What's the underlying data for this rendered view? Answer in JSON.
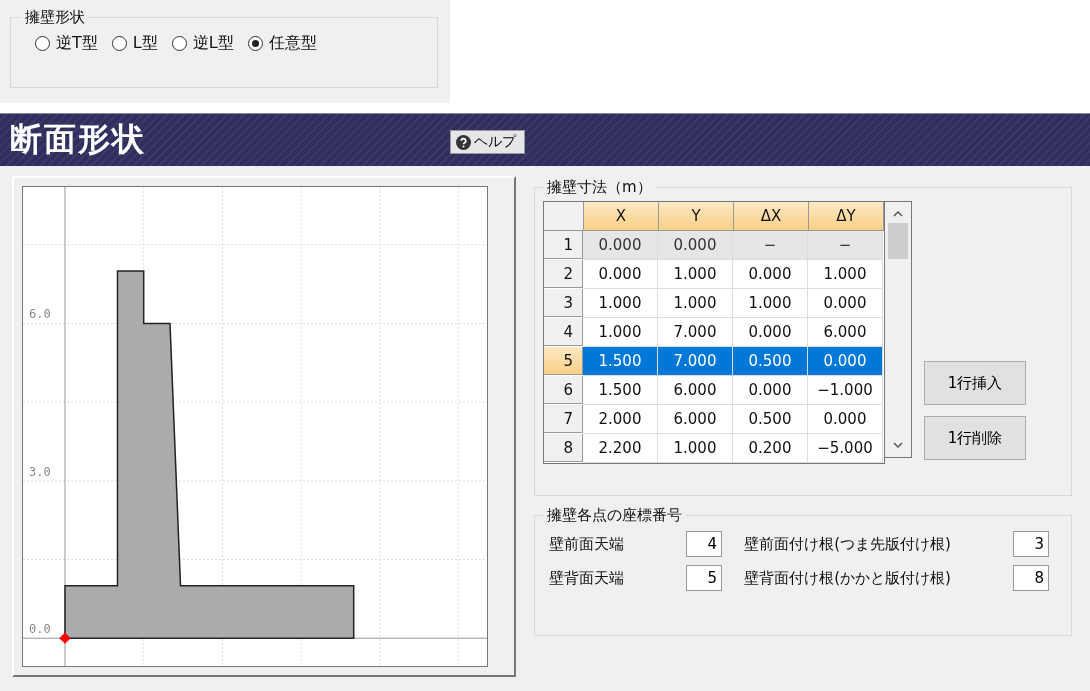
{
  "wall_shape": {
    "title": "擁壁形状",
    "options": [
      {
        "label": "逆T型",
        "selected": false
      },
      {
        "label": "L型",
        "selected": false
      },
      {
        "label": "逆L型",
        "selected": false
      },
      {
        "label": "任意型",
        "selected": true
      }
    ]
  },
  "header": {
    "title": "断面形状",
    "help_button": "ヘルプ"
  },
  "section_view": {
    "y_labels": [
      "6.0",
      "3.0",
      "0.0"
    ]
  },
  "dimensions": {
    "title": "擁壁寸法（m）",
    "columns": [
      "X",
      "Y",
      "ΔX",
      "ΔY"
    ],
    "rows": [
      {
        "index": "1",
        "cells": [
          "0.000",
          "0.000",
          "−",
          "−"
        ],
        "disabled": true,
        "selected": false
      },
      {
        "index": "2",
        "cells": [
          "0.000",
          "1.000",
          "0.000",
          "1.000"
        ],
        "disabled": false,
        "selected": false
      },
      {
        "index": "3",
        "cells": [
          "1.000",
          "1.000",
          "1.000",
          "0.000"
        ],
        "disabled": false,
        "selected": false
      },
      {
        "index": "4",
        "cells": [
          "1.000",
          "7.000",
          "0.000",
          "6.000"
        ],
        "disabled": false,
        "selected": false
      },
      {
        "index": "5",
        "cells": [
          "1.500",
          "7.000",
          "0.500",
          "0.000"
        ],
        "disabled": false,
        "selected": true
      },
      {
        "index": "6",
        "cells": [
          "1.500",
          "6.000",
          "0.000",
          "−1.000"
        ],
        "disabled": false,
        "selected": false
      },
      {
        "index": "7",
        "cells": [
          "2.000",
          "6.000",
          "0.500",
          "0.000"
        ],
        "disabled": false,
        "selected": false
      },
      {
        "index": "8",
        "cells": [
          "2.200",
          "1.000",
          "0.200",
          "−5.000"
        ],
        "disabled": false,
        "selected": false
      }
    ],
    "buttons": [
      "1行挿入",
      "1行削除"
    ]
  },
  "point_numbers": {
    "title": "擁壁各点の座標番号",
    "fields": [
      {
        "label": "壁前面天端",
        "value": "4"
      },
      {
        "label": "壁前面付け根(つま先版付け根)",
        "value": "3"
      },
      {
        "label": "壁背面天端",
        "value": "5"
      },
      {
        "label": "壁背面付け根(かかと版付け根)",
        "value": "8"
      }
    ]
  }
}
